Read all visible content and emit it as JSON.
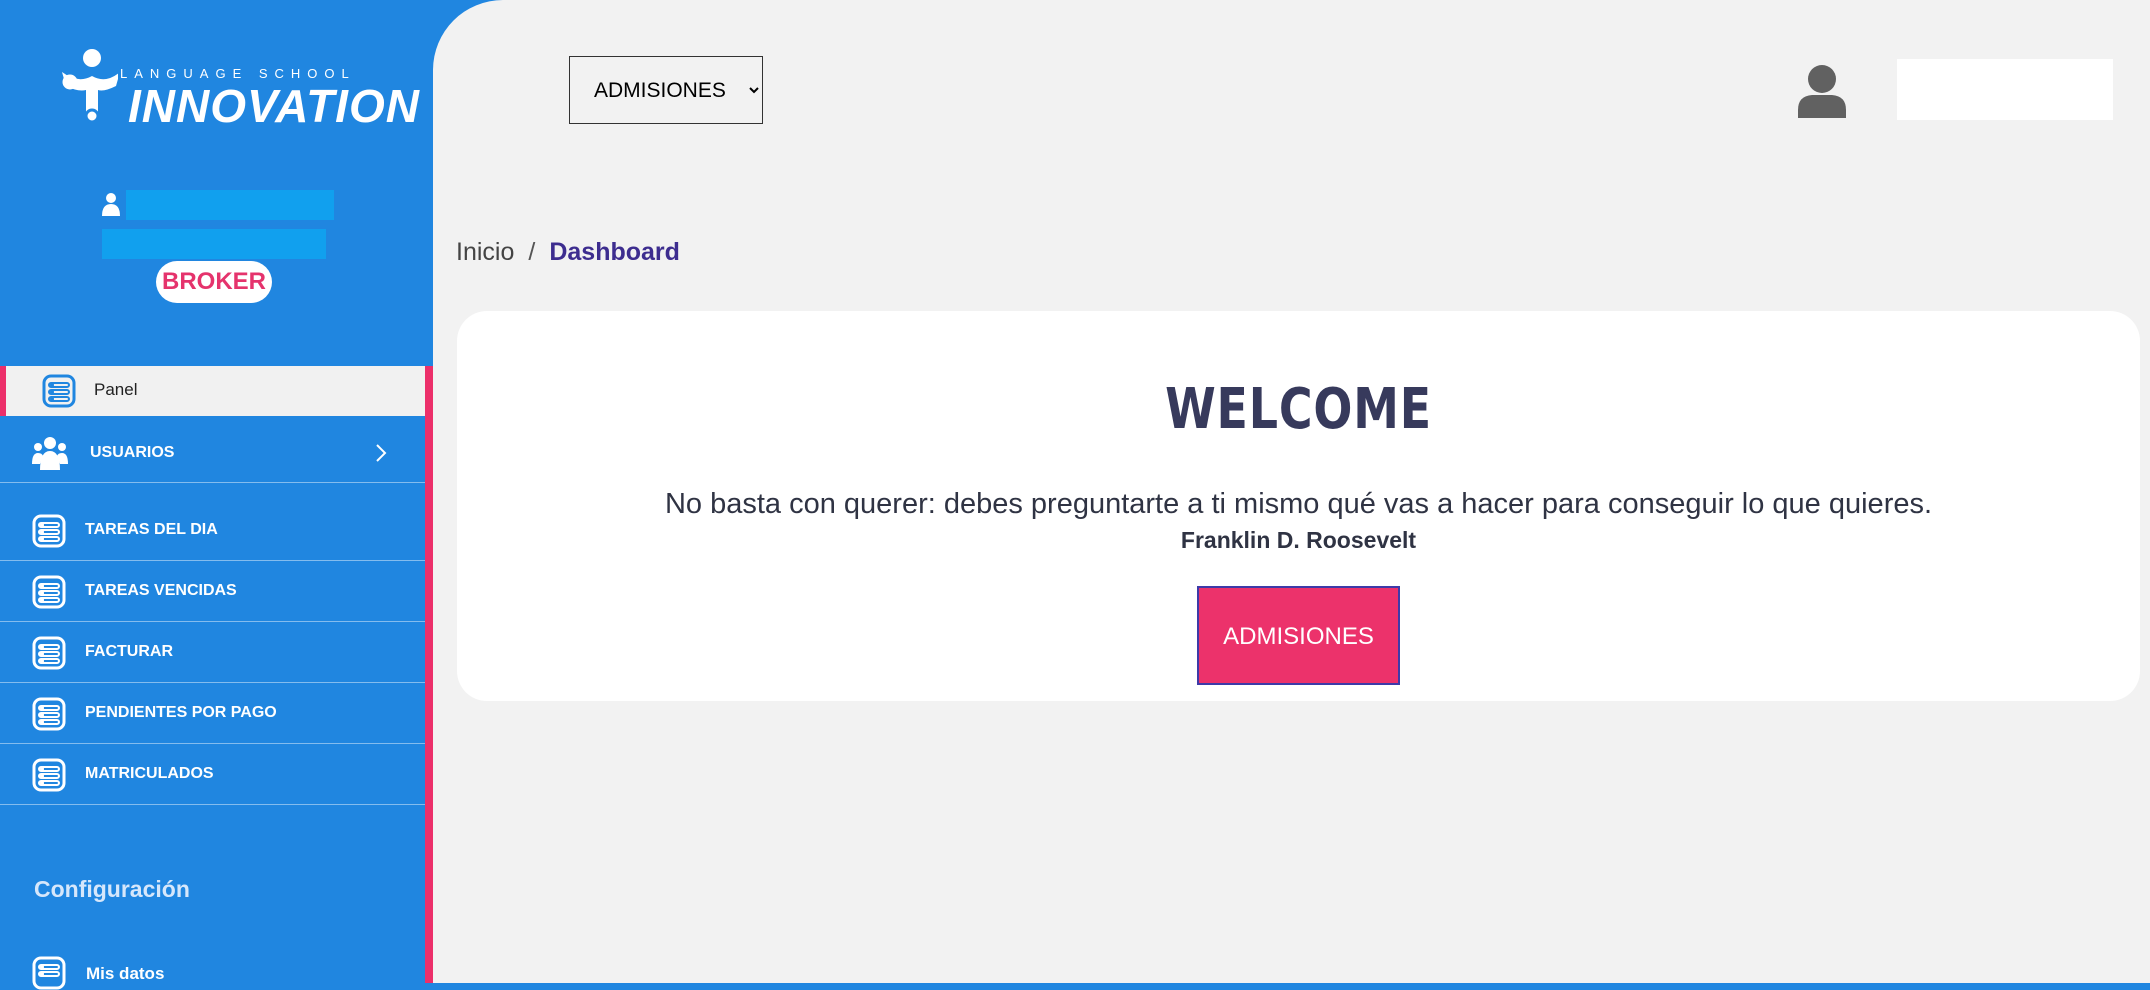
{
  "brand": {
    "tagline": "LANGUAGE SCHOOL",
    "name": "INNOVATION"
  },
  "sidebar": {
    "role_badge": "BROKER",
    "items": [
      {
        "label": "Panel",
        "icon": "list-icon",
        "active": true
      },
      {
        "label": "USUARIOS",
        "icon": "users-icon",
        "has_submenu": true
      },
      {
        "label": "TAREAS DEL DIA",
        "icon": "list-icon"
      },
      {
        "label": "TAREAS VENCIDAS",
        "icon": "list-icon"
      },
      {
        "label": "FACTURAR",
        "icon": "list-icon"
      },
      {
        "label": "PENDIENTES POR PAGO",
        "icon": "list-icon"
      },
      {
        "label": "MATRICULADOS",
        "icon": "list-icon"
      }
    ],
    "section_title": "Configuración",
    "section_items": [
      {
        "label": "Mis datos",
        "icon": "list-icon"
      }
    ]
  },
  "header": {
    "module_select": {
      "selected": "ADMISIONES",
      "options": [
        "ADMISIONES"
      ]
    },
    "avatar_icon": "user-avatar-icon"
  },
  "breadcrumb": {
    "home": "Inicio",
    "separator": "/",
    "current": "Dashboard"
  },
  "welcome_card": {
    "title": "WELCOME",
    "quote": "No basta con querer: debes preguntarte a ti mismo qué vas a hacer para conseguir lo que quieres.",
    "author": "Franklin D. Roosevelt",
    "button_label": "ADMISIONES"
  },
  "colors": {
    "sidebar": "#2086e0",
    "accent_pink": "#ec2f6a",
    "breadcrumb_current": "#3d2d8f",
    "title": "#373a5c"
  }
}
